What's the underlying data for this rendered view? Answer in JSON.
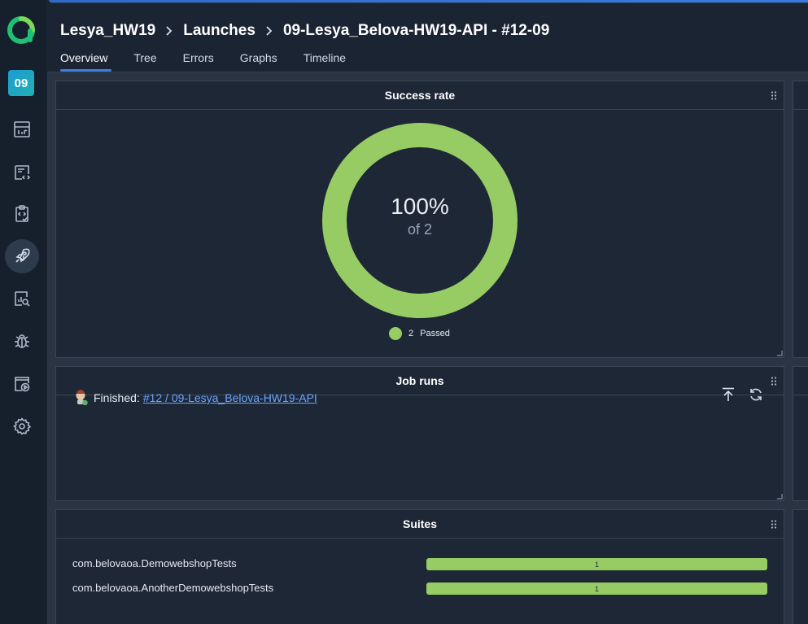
{
  "sidebar": {
    "logo": "allure-logo",
    "project_badge": "09",
    "items": [
      {
        "name": "dashboard-icon"
      },
      {
        "name": "test-cases-icon"
      },
      {
        "name": "test-plans-icon"
      },
      {
        "name": "launches-icon",
        "active": true
      },
      {
        "name": "analytics-icon"
      },
      {
        "name": "defects-icon"
      },
      {
        "name": "jobs-icon"
      },
      {
        "name": "settings-icon"
      }
    ]
  },
  "header": {
    "breadcrumb": [
      "Lesya_HW19",
      "Launches",
      "09-Lesya_Belova-HW19-API - #12-09"
    ],
    "tabs": [
      "Overview",
      "Tree",
      "Errors",
      "Graphs",
      "Timeline"
    ],
    "active_tab": "Overview"
  },
  "widgets": {
    "success_rate": {
      "title": "Success rate",
      "percent_label": "100%",
      "of_label": "of 2",
      "legend_count": "2",
      "legend_label": "Passed",
      "color": "#97cc64"
    },
    "job_runs": {
      "title": "Job runs",
      "status_label": "Finished:",
      "link_text": "#12 / 09-Lesya_Belova-HW19-API"
    },
    "suites": {
      "title": "Suites",
      "rows": [
        {
          "name": "com.belovaoa.DemowebshopTests",
          "count": "1"
        },
        {
          "name": "com.belovaoa.AnotherDemowebshopTests",
          "count": "1"
        }
      ]
    }
  },
  "chart_data": {
    "type": "pie",
    "title": "Success rate",
    "categories": [
      "Passed"
    ],
    "values": [
      2
    ],
    "colors": [
      "#97cc64"
    ]
  }
}
